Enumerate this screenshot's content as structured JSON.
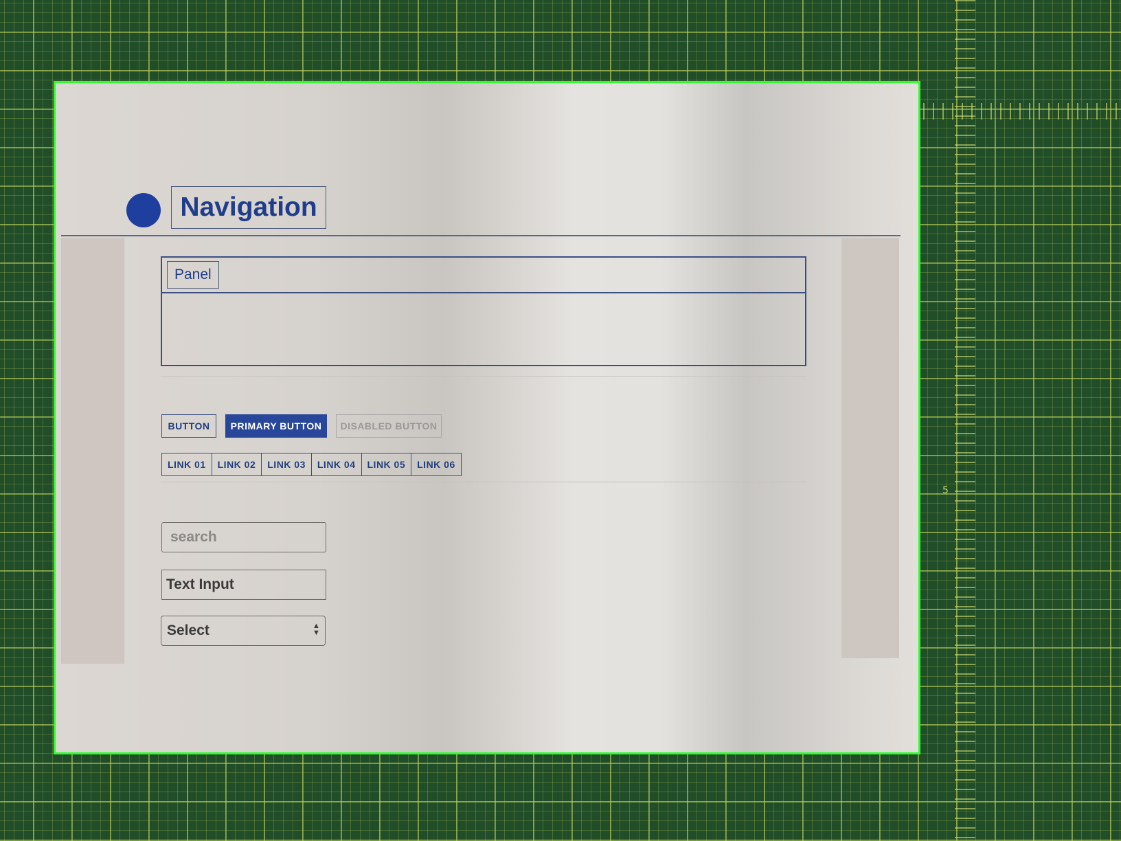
{
  "header": {
    "title": "Navigation",
    "logo_icon": "circle-logo-icon",
    "accent_color": "#1f3f9e"
  },
  "panel": {
    "label": "Panel"
  },
  "buttons": {
    "default_label": "BUTTON",
    "primary_label": "PRIMARY BUTTON",
    "disabled_label": "DISABLED BUTTON"
  },
  "links": [
    "LINK 01",
    "LINK 02",
    "LINK 03",
    "LINK 04",
    "LINK 05",
    "LINK 06"
  ],
  "form": {
    "search_placeholder": "search",
    "text_input_value": "Text Input",
    "select_value": "Select"
  },
  "mat": {
    "ruler_number": "5"
  }
}
